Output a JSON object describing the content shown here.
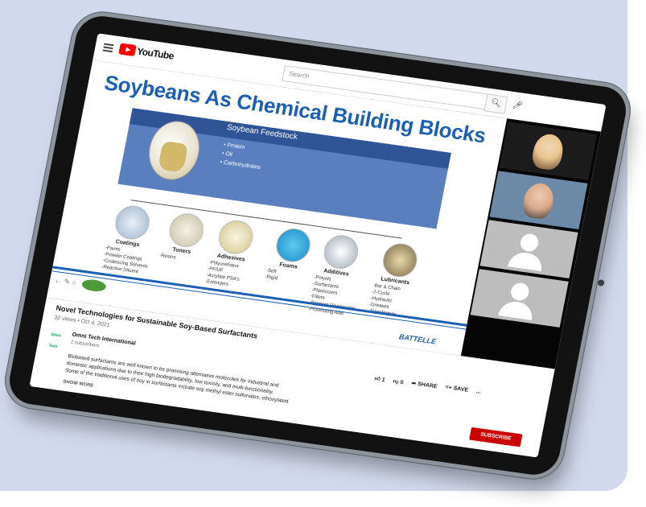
{
  "colors": {
    "background": "#d2d9ec",
    "tablet": "#121212",
    "slide_title": "#1a5fb4",
    "subscribe": "#cc0000"
  },
  "youtube": {
    "logo_text": "YouTube",
    "search_placeholder": "Search",
    "search_icon": "search-icon",
    "mic_icon": "mic-icon"
  },
  "slide": {
    "title": "Soybeans As Chemical Building Blocks",
    "feedstock_title": "Soybean Feedstock",
    "feedstock_items": [
      "• Protein",
      "• Oil",
      "• Carbohydrates"
    ],
    "categories": [
      {
        "name": "Coatings",
        "items": [
          "-Paints",
          "-Powder Coatings",
          "-Coalescing Solvents",
          "-Reactive Diluent"
        ]
      },
      {
        "name": "Toners",
        "items": [
          "-Resins"
        ]
      },
      {
        "name": "Adhesives",
        "items": [
          "-Polyurethane",
          "-PF/UF",
          "-Acrylate PSA's",
          "-Extenders"
        ]
      },
      {
        "name": "Foams",
        "items": [
          "-Soft",
          "-Rigid"
        ]
      },
      {
        "name": "Additives",
        "items": [
          "-Polyols",
          "-Surfactants",
          "-Plasticizers",
          "-Fillers",
          "-Pigment Dispersants",
          "-Processing Aids"
        ]
      },
      {
        "name": "Lubricants",
        "items": [
          "-Bar & Chain",
          "-2-Cycle",
          "-Hydraulic",
          "-Greases",
          "-Transformer"
        ]
      }
    ],
    "footer_logo": "BATTELLE"
  },
  "video": {
    "title": "Novel Technologies for Sustainable Soy-Based Surfactants",
    "meta": "32 views • Oct 4, 2021"
  },
  "channel": {
    "name": "Omni Tech International",
    "subscribers": "2 subscribers",
    "logo_text": "Omni Tech"
  },
  "actions": {
    "likes": "1",
    "dislikes": "0",
    "share": "SHARE",
    "save": "SAVE",
    "more": "..."
  },
  "description": {
    "line1": "Biobased surfactants are well known to be promising alternative molecules for industrial and",
    "line2": "domestic applications due to their high biodegradability, low toxicity, and multi-functionality.",
    "line3": "Some of the traditional uses of soy in surfactants include soy methyl ester sulfonates, ethoxylated",
    "show_more": "SHOW MORE"
  },
  "subscribe_label": "SUBSCRIBE"
}
